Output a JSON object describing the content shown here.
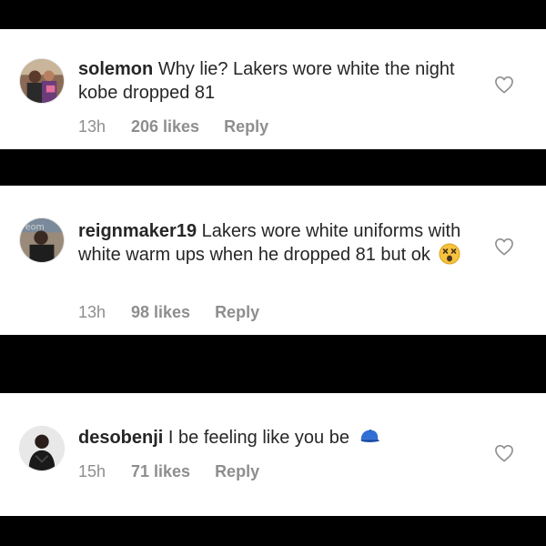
{
  "comments": [
    {
      "username": "solemon",
      "text": "Why lie?  Lakers wore white the night kobe dropped 81",
      "time": "13h",
      "likes": "206 likes",
      "reply": "Reply",
      "emoji": ""
    },
    {
      "username": "reignmaker19",
      "text": "Lakers wore white uniforms with white warm ups when he dropped 81 but ok",
      "time": "13h",
      "likes": "98 likes",
      "reply": "Reply",
      "emoji": "dizzy-face-emoji"
    },
    {
      "username": "desobenji",
      "text": "I be feeling like you be",
      "time": "15h",
      "likes": "71 likes",
      "reply": "Reply",
      "emoji": "blue-cap-emoji"
    }
  ],
  "colors": {
    "background": "#000000",
    "card": "#ffffff",
    "text": "#262626",
    "meta": "#8e8e8e"
  }
}
